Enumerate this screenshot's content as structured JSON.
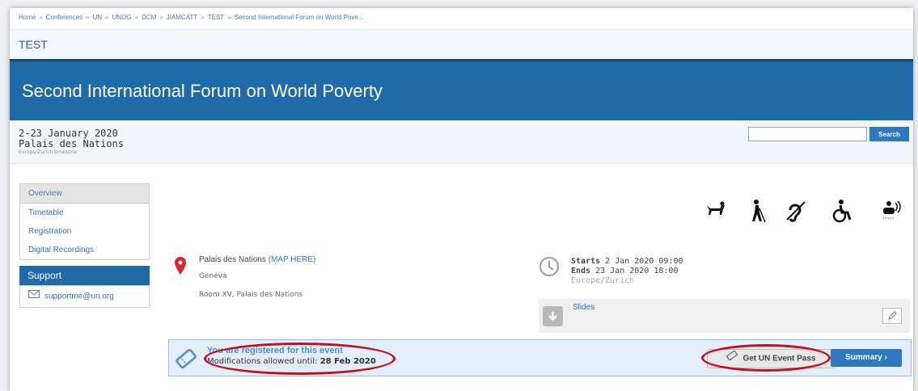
{
  "breadcrumb": [
    "Home",
    "Conferences",
    "UN",
    "UNOG",
    "DCM",
    "JIAMCATT",
    "TEST",
    "Second International Forum on World Pove..."
  ],
  "breadcrumb_separator": "»",
  "category": "TEST",
  "event": {
    "title": "Second International Forum on World Poverty",
    "date_range": "2-23 January 2020",
    "venue": "Palais des Nations",
    "timezone_note": "Europe/Zurich timezone"
  },
  "search": {
    "placeholder": "",
    "button": "Search"
  },
  "sidebar": {
    "menu": [
      {
        "label": "Overview",
        "active": true
      },
      {
        "label": "Timetable",
        "active": false
      },
      {
        "label": "Registration",
        "active": false
      },
      {
        "label": "Digital Recordings",
        "active": false
      }
    ],
    "support_title": "Support",
    "support_email": "supportme@un.org"
  },
  "accessibility_icons": [
    "guide-dog-icon",
    "blind-cane-icon",
    "hearing-loop-icon",
    "wheelchair-icon",
    "sign-language-icon"
  ],
  "location": {
    "name": "Palais des Nations",
    "map_link": "(MAP HERE)",
    "city": "Geneva",
    "room": "Room XV, Palais des Nations"
  },
  "schedule": {
    "starts_label": "Starts",
    "starts": "2 Jan 2020 09:00",
    "ends_label": "Ends",
    "ends": "23 Jan 2020 18:00",
    "tz": "Europe/Zurich"
  },
  "materials": {
    "slides_label": "Slides"
  },
  "registration": {
    "status": "You are registered for this event",
    "modifications_label": "Modifications allowed until:",
    "modifications_date": "28 Feb 2020",
    "pass_button": "Get UN Event Pass",
    "summary_button": "Summary"
  },
  "colors": {
    "brand": "#1f6aa8",
    "link": "#2e79c2",
    "highlight_oval": "#c0121e"
  }
}
